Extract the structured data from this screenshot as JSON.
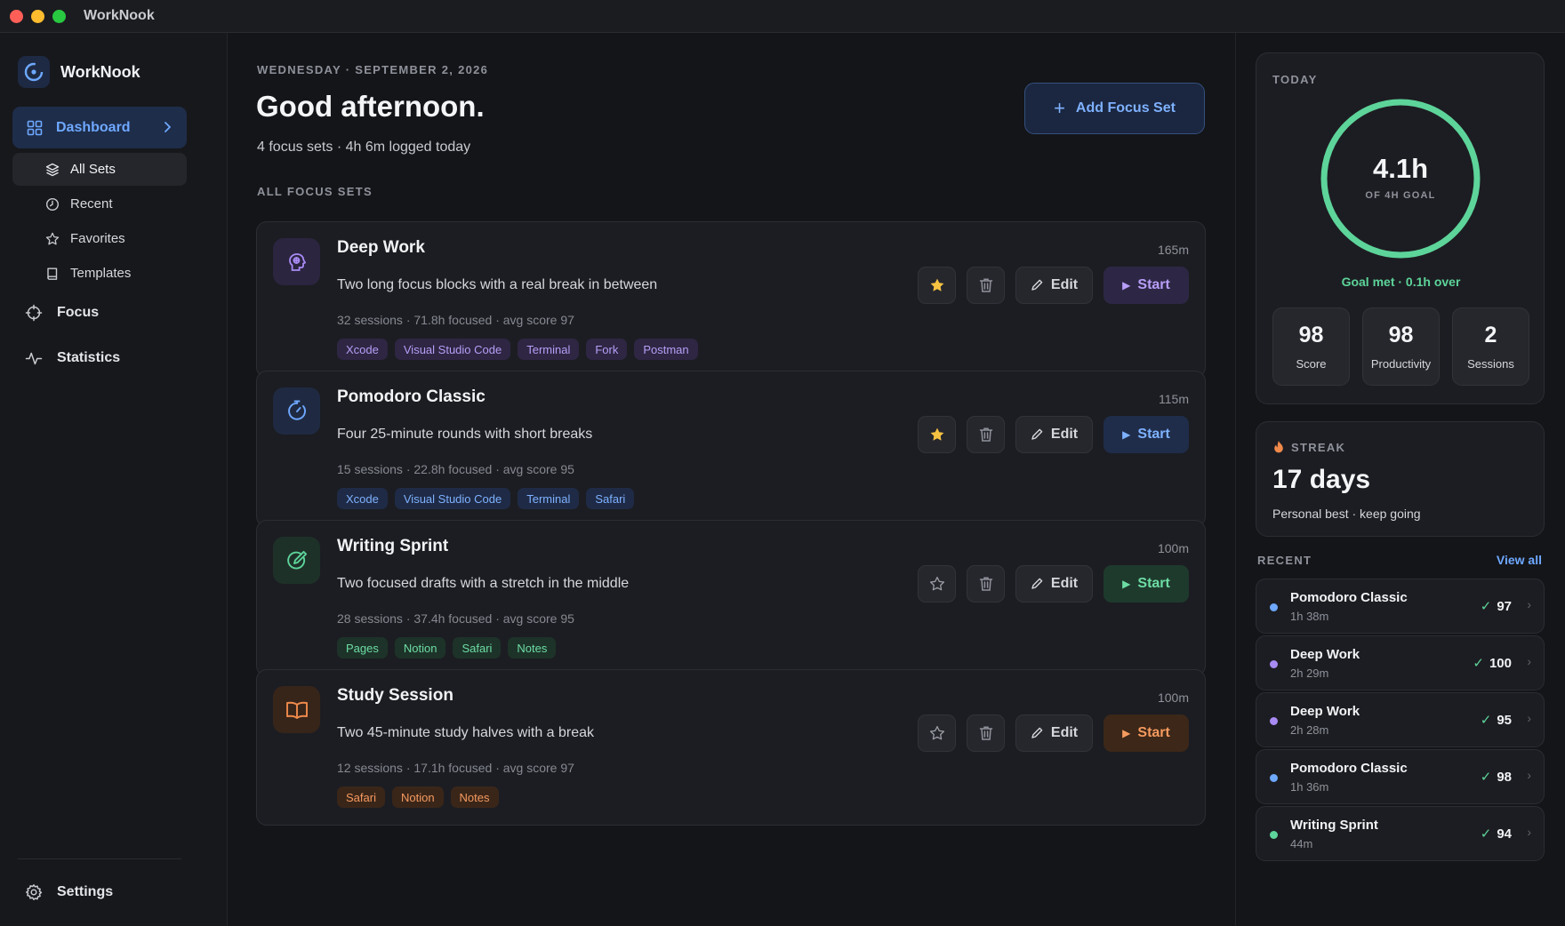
{
  "window": {
    "title": "WorkNook"
  },
  "sidebar": {
    "brand": "WorkNook",
    "dashboard_label": "Dashboard",
    "sub_items": [
      {
        "label": "All Sets",
        "icon": "layers-icon"
      },
      {
        "label": "Recent",
        "icon": "clock-icon"
      },
      {
        "label": "Favorites",
        "icon": "star-icon"
      },
      {
        "label": "Templates",
        "icon": "book-icon"
      }
    ],
    "focus_label": "Focus",
    "statistics_label": "Statistics",
    "settings_label": "Settings"
  },
  "main": {
    "date": "WEDNESDAY · SEPTEMBER 2, 2026",
    "greeting": "Good afternoon.",
    "summary": "4 focus sets · 4h 6m logged today",
    "add_button": "Add Focus Set",
    "section_label": "ALL FOCUS SETS",
    "edit_label": "Edit",
    "start_label": "Start",
    "sets": [
      {
        "title": "Deep Work",
        "duration": "165m",
        "description": "Two long focus blocks with a real break in between",
        "stats": "32 sessions · 71.8h focused · avg score 97",
        "tags": [
          "Xcode",
          "Visual Studio Code",
          "Terminal",
          "Fork",
          "Postman"
        ],
        "favorite": true,
        "accent": "#a98bf5",
        "icon": "brain-icon"
      },
      {
        "title": "Pomodoro Classic",
        "duration": "115m",
        "description": "Four 25-minute rounds with short breaks",
        "stats": "15 sessions · 22.8h focused · avg score 95",
        "tags": [
          "Xcode",
          "Visual Studio Code",
          "Terminal",
          "Safari"
        ],
        "favorite": true,
        "accent": "#6ea8ff",
        "icon": "timer-icon"
      },
      {
        "title": "Writing Sprint",
        "duration": "100m",
        "description": "Two focused drafts with a stretch in the middle",
        "stats": "28 sessions · 37.4h focused · avg score 95",
        "tags": [
          "Pages",
          "Notion",
          "Safari",
          "Notes"
        ],
        "favorite": false,
        "accent": "#5dd49a",
        "icon": "pencil-circle-icon"
      },
      {
        "title": "Study Session",
        "duration": "100m",
        "description": "Two 45-minute study halves with a break",
        "stats": "12 sessions · 17.1h focused · avg score 97",
        "tags": [
          "Safari",
          "Notion",
          "Notes"
        ],
        "favorite": false,
        "accent": "#f08a4b",
        "icon": "open-book-icon"
      }
    ]
  },
  "today": {
    "label": "TODAY",
    "value": "4.1h",
    "goal_text": "OF 4H GOAL",
    "goal_status": "Goal met · 0.1h over",
    "progress": 1.0,
    "ring_color": "#5dd49a",
    "stats": [
      {
        "value": "98",
        "label": "Score"
      },
      {
        "value": "98",
        "label": "Productivity"
      },
      {
        "value": "2",
        "label": "Sessions"
      }
    ]
  },
  "streak": {
    "label": "STREAK",
    "days": "17 days",
    "note": "Personal best · keep going"
  },
  "recent": {
    "label": "RECENT",
    "view_all": "View all",
    "items": [
      {
        "name": "Pomodoro Classic",
        "duration": "1h 38m",
        "score": "97",
        "color": "#6ea8ff"
      },
      {
        "name": "Deep Work",
        "duration": "2h 29m",
        "score": "100",
        "color": "#a98bf5"
      },
      {
        "name": "Deep Work",
        "duration": "2h 28m",
        "score": "95",
        "color": "#a98bf5"
      },
      {
        "name": "Pomodoro Classic",
        "duration": "1h 36m",
        "score": "98",
        "color": "#6ea8ff"
      },
      {
        "name": "Writing Sprint",
        "duration": "44m",
        "score": "94",
        "color": "#5dd49a"
      }
    ]
  }
}
